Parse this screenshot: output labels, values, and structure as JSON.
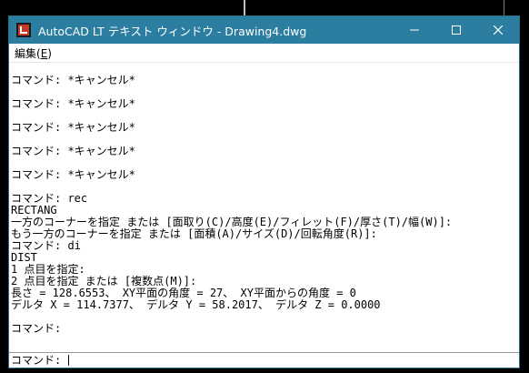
{
  "window": {
    "title": "AutoCAD LT テキスト ウィンドウ - Drawing4.dwg"
  },
  "menu": {
    "edit_label": "編集(",
    "edit_key": "E",
    "edit_close": ")"
  },
  "history_lines": [
    "",
    "コマンド: *キャンセル*",
    "",
    "コマンド: *キャンセル*",
    "",
    "コマンド: *キャンセル*",
    "",
    "コマンド: *キャンセル*",
    "",
    "コマンド: *キャンセル*",
    "",
    "コマンド: rec",
    "RECTANG",
    "一方のコーナーを指定 または [面取り(C)/高度(E)/フィレット(F)/厚さ(T)/幅(W)]:",
    "もう一方のコーナーを指定 または [面積(A)/サイズ(D)/回転角度(R)]:",
    "コマンド: di",
    "DIST",
    "1 点目を指定:",
    "2 点目を指定 または [複数点(M)]:",
    "長さ = 128.6553、 XY平面の角度 = 27、 XY平面からの角度 = 0",
    "デルタ X = 114.7377、 デルタ Y = 58.2017、 デルタ Z = 0.0000",
    "",
    "コマンド:",
    ""
  ],
  "command_line": {
    "prompt": "コマンド: "
  }
}
